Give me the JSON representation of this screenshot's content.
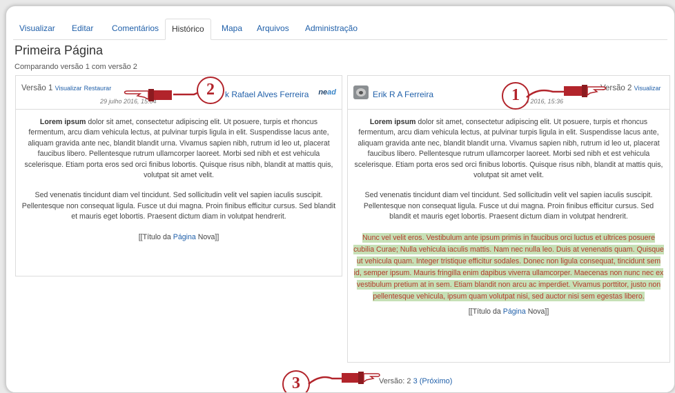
{
  "tabs": [
    {
      "label": "Visualizar",
      "active": false
    },
    {
      "label": "Editar",
      "active": false
    },
    {
      "label": "Comentários",
      "active": false
    },
    {
      "label": "Histórico",
      "active": true
    },
    {
      "label": "Mapa",
      "active": false
    },
    {
      "label": "Arquivos",
      "active": false
    },
    {
      "label": "Administração",
      "active": false
    }
  ],
  "page": {
    "title": "Primeira Página",
    "subtitle": "Comparando versão 1 com versão 2"
  },
  "left_panel": {
    "version_label": "Versão 1",
    "view_link": "Visualizar",
    "restore_link": "Restaurar",
    "date": "29 julho 2016, 15:04",
    "author": "k Rafael Alves Ferreira",
    "badge_main": "ne",
    "badge_accent": "ad",
    "para1_bold": "Lorem ipsum",
    "para1": " dolor sit amet, consectetur adipiscing elit. Ut posuere, turpis et rhoncus fermentum, arcu diam vehicula lectus, at pulvinar turpis ligula in elit. Suspendisse lacus ante, aliquam gravida ante nec, blandit blandit urna. Vivamus sapien nibh, rutrum id leo ut, placerat faucibus libero. Pellentesque rutrum ullamcorper laoreet. Morbi sed nibh et est vehicula scelerisque. Etiam porta eros sed orci finibus lobortis. Quisque risus nibh, blandit at mattis quis, volutpat sit amet velit.",
    "para2": "Sed venenatis tincidunt diam vel tincidunt. Sed sollicitudin velit vel sapien iaculis suscipit. Pellentesque non consequat ligula. Fusce ut dui magna. Proin finibus efficitur cursus. Sed blandit et mauris eget lobortis. Praesent dictum diam in volutpat hendrerit.",
    "link_prefix": "[[Título da ",
    "link_word": "Página",
    "link_suffix": " Nova]]"
  },
  "right_panel": {
    "author": "Erik R A Ferreira",
    "date": "lho 2016, 15:36",
    "version_label": "Versão 2",
    "view_link": "Visualizar",
    "para1_bold": "Lorem ipsum",
    "para1": " dolor sit amet, consectetur adipiscing elit. Ut posuere, turpis et rhoncus fermentum, arcu diam vehicula lectus, at pulvinar turpis ligula in elit. Suspendisse lacus ante, aliquam gravida ante nec, blandit blandit urna. Vivamus sapien nibh, rutrum id leo ut, placerat faucibus libero. Pellentesque rutrum ullamcorper laoreet. Morbi sed nibh et est vehicula scelerisque. Etiam porta eros sed orci finibus lobortis. Quisque risus nibh, blandit at mattis quis, volutpat sit amet velit.",
    "para2": "Sed venenatis tincidunt diam vel tincidunt. Sed sollicitudin velit vel sapien iaculis suscipit. Pellentesque non consequat ligula. Fusce ut dui magna. Proin finibus efficitur cursus. Sed blandit et mauris eget lobortis. Praesent dictum diam in volutpat hendrerit.",
    "added_text": "Nunc vel velit eros. Vestibulum ante ipsum primis in faucibus orci luctus et ultrices posuere cubilia Curae; Nulla vehicula iaculis mattis. Nam nec nulla leo. Duis at venenatis quam. Quisque ut vehicula quam. Integer tristique efficitur sodales. Donec non ligula consequat, tincidunt sem id, semper ipsum. Mauris fringilla enim dapibus viverra ullamcorper. Maecenas non nunc nec ex vestibulum pretium at in sem. Etiam blandit non arcu ac imperdiet. Vivamus porttitor, justo non pellentesque vehicula, ipsum quam volutpat nisi, sed auctor nisi sem egestas libero.",
    "link_prefix": "[[Título da ",
    "link_word": "Página",
    "link_suffix": " Nova]]"
  },
  "pager": {
    "label": "Versão:",
    "current": "2",
    "next_num": "3",
    "next_label": "(Próximo)"
  },
  "callouts": [
    "1",
    "2",
    "3"
  ],
  "colors": {
    "accent_red": "#b2242b",
    "link_blue": "#1f5fa9",
    "added_bg": "#c6e0b6",
    "added_text": "#b23a2a"
  }
}
